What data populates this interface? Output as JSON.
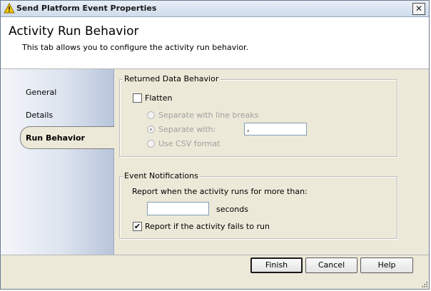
{
  "window": {
    "title": "Send Platform Event Properties",
    "close_glyph": "✕"
  },
  "header": {
    "title": "Activity Run Behavior",
    "description": "This tab allows you to configure the activity run behavior."
  },
  "nav": {
    "items": [
      {
        "label": "General",
        "selected": false
      },
      {
        "label": "Details",
        "selected": false
      },
      {
        "label": "Run Behavior",
        "selected": true
      }
    ]
  },
  "returned_data": {
    "group_label": "Returned Data Behavior",
    "flatten_label": "Flatten",
    "flatten_checked": false,
    "options": [
      {
        "label": "Separate with line breaks",
        "selected": false
      },
      {
        "label": "Separate with:",
        "selected": true
      },
      {
        "label": "Use CSV format",
        "selected": false
      }
    ],
    "separator_value": ","
  },
  "notifications": {
    "group_label": "Event Notifications",
    "report_duration_label": "Report when the activity runs for more than:",
    "duration_value": "",
    "seconds_label": "seconds",
    "report_fail_label": "Report if the activity fails to run",
    "report_fail_checked": true,
    "check_glyph": "✔"
  },
  "buttons": {
    "finish": "Finish",
    "cancel": "Cancel",
    "help": "Help"
  },
  "icons": {
    "title_icon": "warning-icon",
    "close": "close-icon",
    "resize": "resize-grip-icon"
  }
}
